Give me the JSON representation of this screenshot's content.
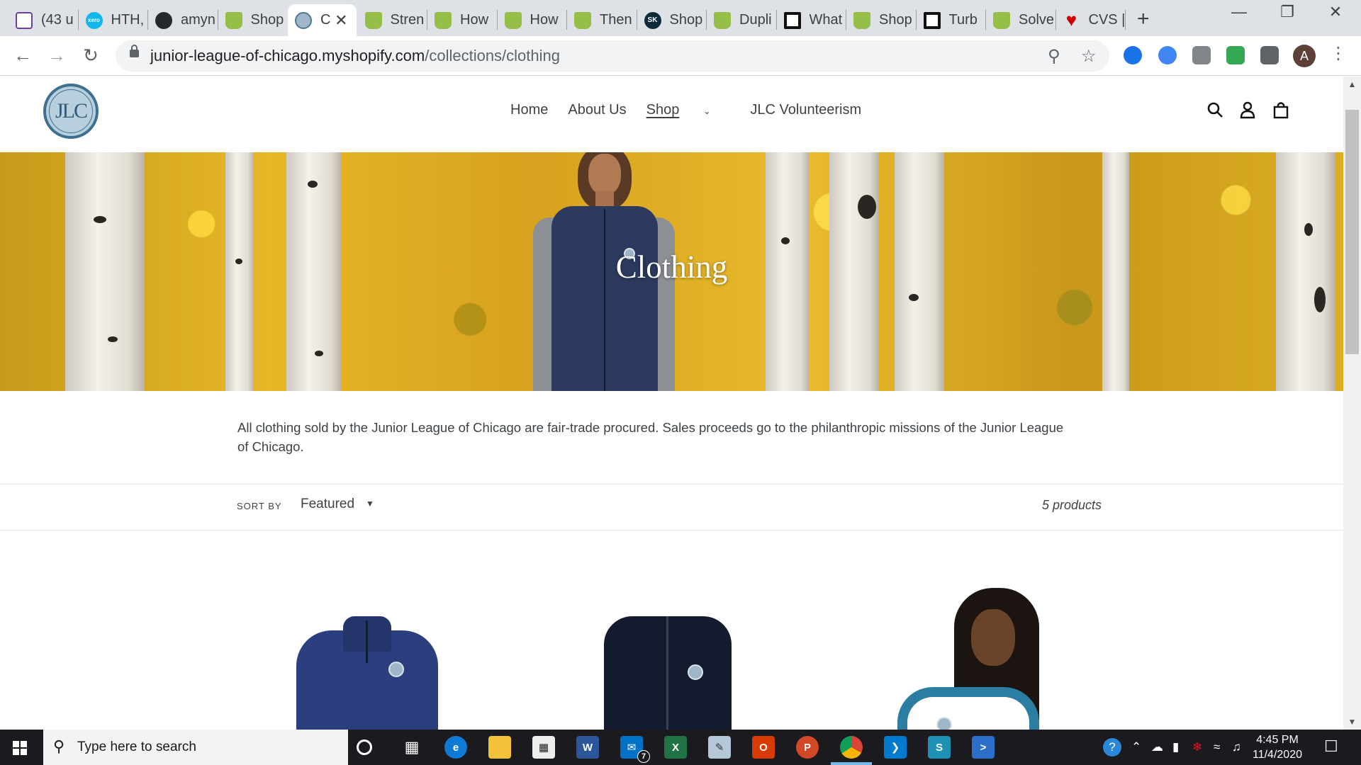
{
  "browser": {
    "tabs": [
      {
        "title": "(43 u",
        "icon": "mail-icon"
      },
      {
        "title": "HTH,",
        "icon": "xero-icon"
      },
      {
        "title": "amyn",
        "icon": "github-icon"
      },
      {
        "title": "Shop",
        "icon": "shopify-icon"
      },
      {
        "title": "C",
        "icon": "jlc-icon",
        "active": true
      },
      {
        "title": "Stren",
        "icon": "shopify-icon"
      },
      {
        "title": "How",
        "icon": "shopify-icon"
      },
      {
        "title": "How",
        "icon": "shopify-icon"
      },
      {
        "title": "Then",
        "icon": "shopify-icon"
      },
      {
        "title": "Shop",
        "icon": "sk-icon"
      },
      {
        "title": "Dupli",
        "icon": "shopify-icon"
      },
      {
        "title": "What",
        "icon": "square-icon"
      },
      {
        "title": "Shop",
        "icon": "shopify-icon"
      },
      {
        "title": "Turb",
        "icon": "square-icon"
      },
      {
        "title": "Solve",
        "icon": "shopify-icon"
      },
      {
        "title": "CVS |",
        "icon": "heart-icon"
      }
    ],
    "address": {
      "host": "junior-league-of-chicago.myshopify.com",
      "path": "/collections/clothing"
    },
    "profile_initial": "A"
  },
  "site": {
    "logo_text": "JLC",
    "nav": {
      "home": "Home",
      "about": "About Us",
      "shop": "Shop",
      "volunteer": "JLC Volunteerism"
    }
  },
  "collection": {
    "title": "Clothing",
    "description": "All clothing sold by the Junior League of Chicago are fair-trade procured. Sales proceeds go to the philanthropic missions of the Junior League of Chicago.",
    "sort_label": "SORT BY",
    "sort_value": "Featured",
    "product_count": "5 products"
  },
  "taskbar": {
    "search_placeholder": "Type here to search",
    "mail_badge": "7",
    "time": "4:45 PM",
    "date": "11/4/2020"
  },
  "colors": {
    "tab_strip": "#dee1e6",
    "brand_blue": "#3f6f91",
    "hero_yellow": "#e6b726",
    "taskbar": "#1b1b1f"
  }
}
